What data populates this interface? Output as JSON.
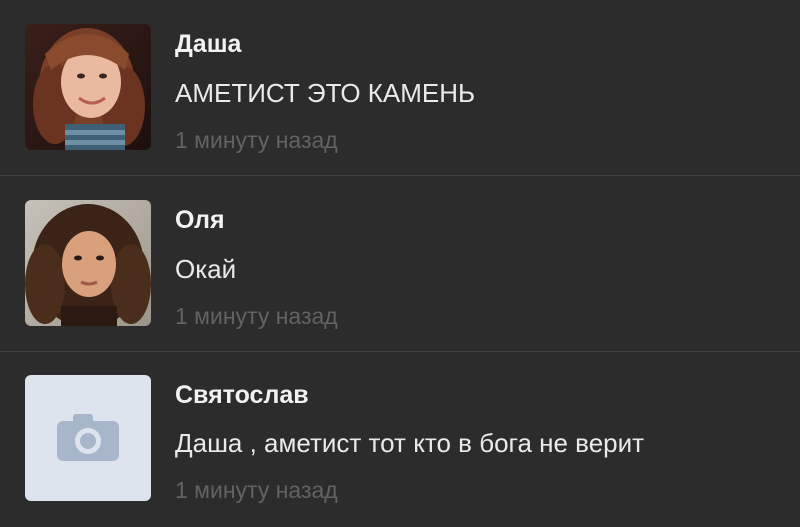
{
  "comments": [
    {
      "author": "Даша",
      "text": "АМЕТИСТ ЭТО КАМЕНЬ",
      "time": "1 минуту назад",
      "avatar_icon": "user-photo-avatar"
    },
    {
      "author": "Оля",
      "text": "Окай",
      "time": "1 минуту назад",
      "avatar_icon": "user-photo-avatar"
    },
    {
      "author": "Святослав",
      "text": "Даша , аметист тот кто в бога не верит",
      "time": "1 минуту назад",
      "avatar_icon": "camera-icon"
    }
  ],
  "colors": {
    "background": "#2c2c2d",
    "divider": "#424244",
    "author": "#f2f2f2",
    "text": "#eaeaea",
    "time": "#626265",
    "placeholder_bg": "#dde4ee",
    "camera": "#a7b6c9"
  }
}
